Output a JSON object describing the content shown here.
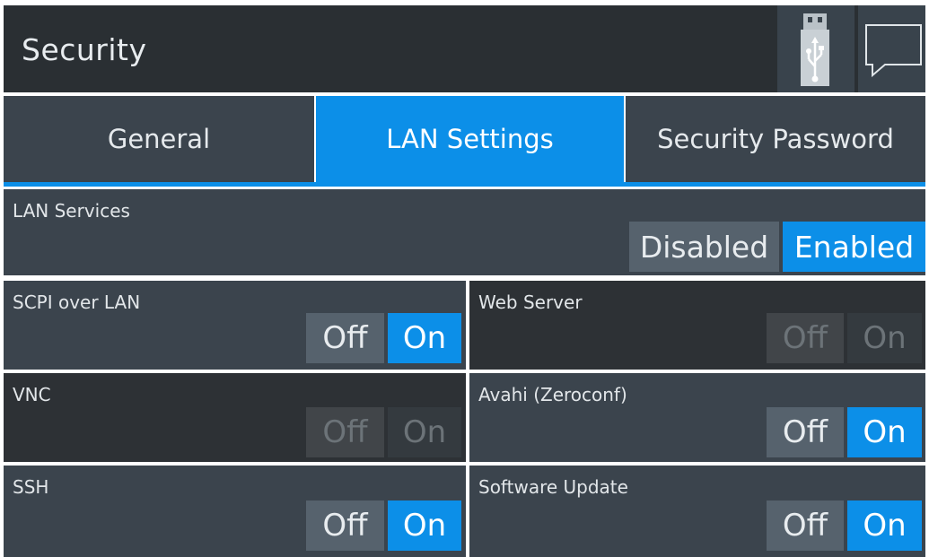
{
  "header": {
    "title": "Security",
    "usb_icon": "usb-icon",
    "message_icon": "message-icon"
  },
  "tabs": [
    {
      "label": "General",
      "active": false
    },
    {
      "label": "LAN Settings",
      "active": true
    },
    {
      "label": "Security Password",
      "active": false
    }
  ],
  "lan_services": {
    "label": "LAN Services",
    "disabled_label": "Disabled",
    "enabled_label": "Enabled",
    "selected": "Enabled"
  },
  "services": {
    "scpi": {
      "label": "SCPI over LAN",
      "off_label": "Off",
      "on_label": "On",
      "selected": "On",
      "enabled": true
    },
    "web_server": {
      "label": "Web Server",
      "off_label": "Off",
      "on_label": "On",
      "selected": "",
      "enabled": false
    },
    "vnc": {
      "label": "VNC",
      "off_label": "Off",
      "on_label": "On",
      "selected": "",
      "enabled": false
    },
    "avahi": {
      "label": "Avahi (Zeroconf)",
      "off_label": "Off",
      "on_label": "On",
      "selected": "On",
      "enabled": true
    },
    "ssh": {
      "label": "SSH",
      "off_label": "Off",
      "on_label": "On",
      "selected": "On",
      "enabled": true
    },
    "software_update": {
      "label": "Software Update",
      "off_label": "Off",
      "on_label": "On",
      "selected": "On",
      "enabled": true
    }
  },
  "colors": {
    "accent": "#0c8fe8",
    "panel": "#3b444d",
    "panel_disabled": "#2d3135",
    "header": "#2a2f33"
  }
}
